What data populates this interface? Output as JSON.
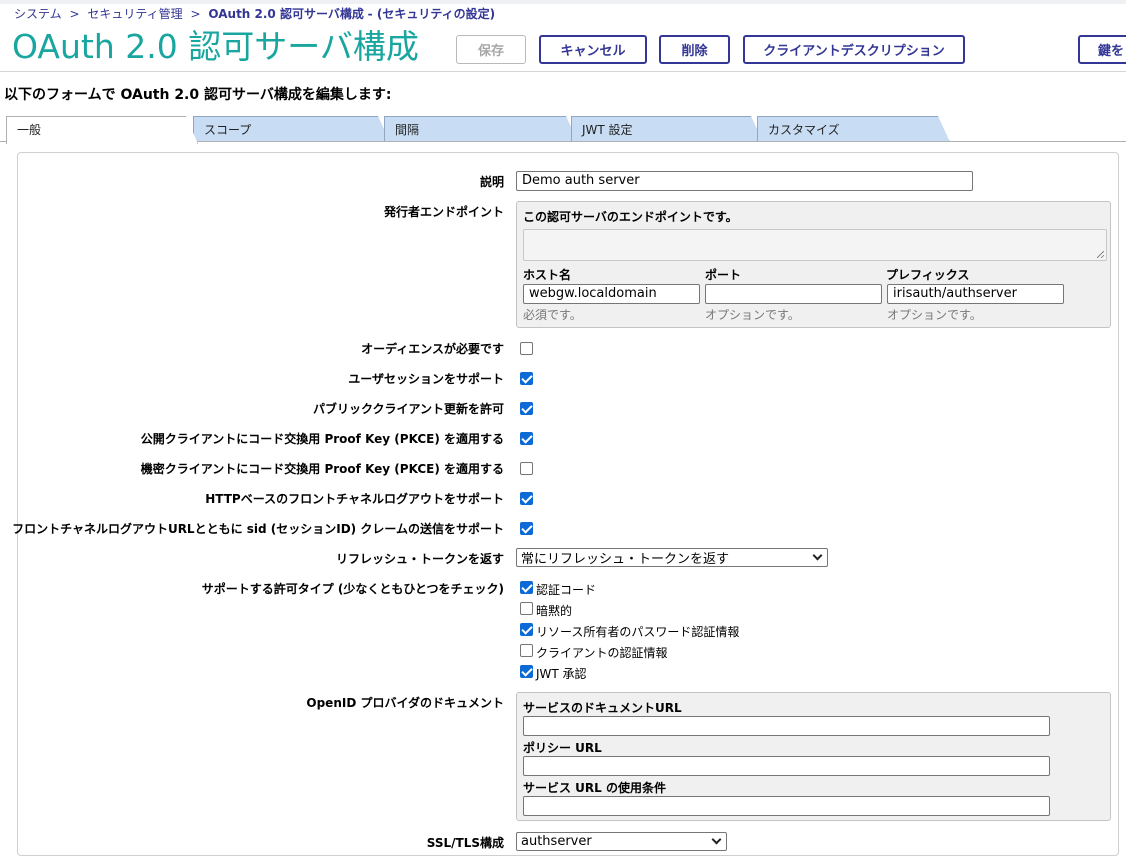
{
  "breadcrumb": {
    "items": [
      "システム",
      "セキュリティ管理"
    ],
    "current": "OAuth 2.0 認可サーバ構成",
    "suffix": " - (セキュリティの設定)",
    "separator": ">"
  },
  "page_title": "OAuth 2.0 認可サーバ構成",
  "toolbar": {
    "save_label": "保存",
    "cancel_label": "キャンセル",
    "delete_label": "削除",
    "client_desc_label": "クライアントデスクリプション",
    "keys_label": "鍵を"
  },
  "instructions": "以下のフォームで OAuth 2.0 認可サーバ構成を編集します:",
  "tabs": [
    "一般",
    "スコープ",
    "間隔",
    "JWT 設定",
    "カスタマイズ"
  ],
  "form": {
    "description": {
      "label": "説明",
      "value": "Demo auth server"
    },
    "issuer": {
      "label": "発行者エンドポイント",
      "info": "この認可サーバのエンドポイントです。",
      "host_label": "ホスト名",
      "host_value": "webgw.localdomain",
      "host_hint": "必須です。",
      "port_label": "ポート",
      "port_value": "",
      "port_hint": "オプションです。",
      "prefix_label": "プレフィックス",
      "prefix_value": "irisauth/authserver",
      "prefix_hint": "オプションです。"
    },
    "checkboxes": [
      {
        "label": "オーディエンスが必要です",
        "checked": false
      },
      {
        "label": "ユーザセッションをサポート",
        "checked": true
      },
      {
        "label": "パブリッククライアント更新を許可",
        "checked": true
      },
      {
        "label": "公開クライアントにコード交換用 Proof Key (PKCE) を適用する",
        "checked": true
      },
      {
        "label": "機密クライアントにコード交換用 Proof Key (PKCE) を適用する",
        "checked": false
      },
      {
        "label": "HTTPベースのフロントチャネルログアウトをサポート",
        "checked": true
      },
      {
        "label": "フロントチャネルログアウトURLとともに sid (セッションID) クレームの送信をサポート",
        "checked": true
      }
    ],
    "refresh": {
      "label": "リフレッシュ・トークンを返す",
      "value": "常にリフレッシュ・トークンを返す"
    },
    "grant_types": {
      "label": "サポートする許可タイプ (少なくともひとつをチェック)",
      "items": [
        {
          "label": "認証コード",
          "checked": true
        },
        {
          "label": "暗黙的",
          "checked": false
        },
        {
          "label": "リソース所有者のパスワード認証情報",
          "checked": true
        },
        {
          "label": "クライアントの認証情報",
          "checked": false
        },
        {
          "label": "JWT 承認",
          "checked": true
        }
      ]
    },
    "openid": {
      "label": "OpenID プロバイダのドキュメント",
      "service_doc_label": "サービスのドキュメントURL",
      "service_doc_value": "",
      "policy_label": "ポリシー URL",
      "policy_value": "",
      "tos_label": "サービス URL の使用条件",
      "tos_value": ""
    },
    "ssl": {
      "label": "SSL/TLS構成",
      "value": "authserver"
    }
  },
  "colors": {
    "accent": "#333695",
    "title": "#19a6a0",
    "tab": "#c8ddf4",
    "checkbox": "#0b6ad5"
  }
}
